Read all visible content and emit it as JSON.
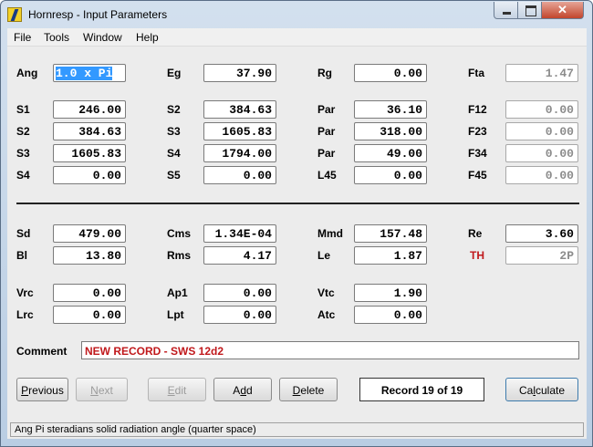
{
  "window": {
    "title": "Hornresp - Input Parameters"
  },
  "menu": [
    "File",
    "Tools",
    "Window",
    "Help"
  ],
  "params": {
    "ang": {
      "label": "Ang",
      "value": "1.0 x Pi"
    },
    "eg": {
      "label": "Eg",
      "value": "37.90"
    },
    "rg": {
      "label": "Rg",
      "value": "0.00"
    },
    "fta": {
      "label": "Fta",
      "value": "1.47"
    },
    "s1": {
      "label": "S1",
      "value": "246.00"
    },
    "s2a": {
      "label": "S2",
      "value": "384.63"
    },
    "par1": {
      "label": "Par",
      "value": "36.10"
    },
    "f12": {
      "label": "F12",
      "value": "0.00"
    },
    "s2b": {
      "label": "S2",
      "value": "384.63"
    },
    "s3a": {
      "label": "S3",
      "value": "1605.83"
    },
    "par2": {
      "label": "Par",
      "value": "318.00"
    },
    "f23": {
      "label": "F23",
      "value": "0.00"
    },
    "s3b": {
      "label": "S3",
      "value": "1605.83"
    },
    "s4a": {
      "label": "S4",
      "value": "1794.00"
    },
    "par3": {
      "label": "Par",
      "value": "49.00"
    },
    "f34": {
      "label": "F34",
      "value": "0.00"
    },
    "s4b": {
      "label": "S4",
      "value": "0.00"
    },
    "s5": {
      "label": "S5",
      "value": "0.00"
    },
    "l45": {
      "label": "L45",
      "value": "0.00"
    },
    "f45": {
      "label": "F45",
      "value": "0.00"
    },
    "sd": {
      "label": "Sd",
      "value": "479.00"
    },
    "cms": {
      "label": "Cms",
      "value": "1.34E-04"
    },
    "mmd": {
      "label": "Mmd",
      "value": "157.48"
    },
    "re": {
      "label": "Re",
      "value": "3.60"
    },
    "bl": {
      "label": "Bl",
      "value": "13.80"
    },
    "rms": {
      "label": "Rms",
      "value": "4.17"
    },
    "le": {
      "label": "Le",
      "value": "1.87"
    },
    "th": {
      "label": "TH",
      "value": "2P"
    },
    "vrc": {
      "label": "Vrc",
      "value": "0.00"
    },
    "ap1": {
      "label": "Ap1",
      "value": "0.00"
    },
    "vtc": {
      "label": "Vtc",
      "value": "1.90"
    },
    "lrc": {
      "label": "Lrc",
      "value": "0.00"
    },
    "lpt": {
      "label": "Lpt",
      "value": "0.00"
    },
    "atc": {
      "label": "Atc",
      "value": "0.00"
    }
  },
  "comment": {
    "label": "Comment",
    "value": "NEW RECORD - SWS 12d2"
  },
  "buttons": {
    "previous_u": "P",
    "previous_rest": "revious",
    "next_u": "N",
    "next_rest": "ext",
    "edit_u": "E",
    "edit_rest": "dit",
    "add_pre": "A",
    "add_u": "d",
    "add_rest": "d",
    "delete_u": "D",
    "delete_rest": "elete",
    "calculate_pre": "Ca",
    "calculate_u": "l",
    "calculate_rest": "culate"
  },
  "record": "Record 19 of 19",
  "status": "Ang   Pi steradians solid radiation angle  (quarter space)",
  "colors": {
    "accent_red": "#c0181b",
    "selection": "#3399ff"
  }
}
